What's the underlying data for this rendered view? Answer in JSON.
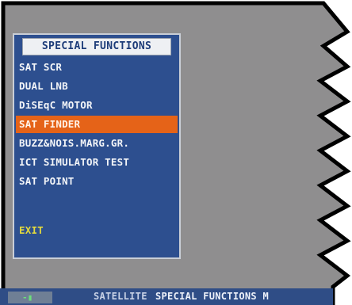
{
  "menu": {
    "title": "SPECIAL FUNCTIONS",
    "items": [
      {
        "label": "SAT SCR"
      },
      {
        "label": "DUAL LNB"
      },
      {
        "label": "DiSEqC MOTOR"
      },
      {
        "label": "SAT FINDER",
        "selected": true
      },
      {
        "label": "BUZZ&NOIS.MARG.GR."
      },
      {
        "label": "ICT SIMULATOR TEST"
      },
      {
        "label": "SAT POINT"
      }
    ],
    "exit_label": "EXIT"
  },
  "statusbar": {
    "indicator": "-▮",
    "mode": "SATELLITE",
    "function": "SPECIAL FUNCTIONS M"
  },
  "colors": {
    "panel_bg": "#2d4f8f",
    "selected_bg": "#e56318",
    "exit_text": "#e4da3c"
  }
}
